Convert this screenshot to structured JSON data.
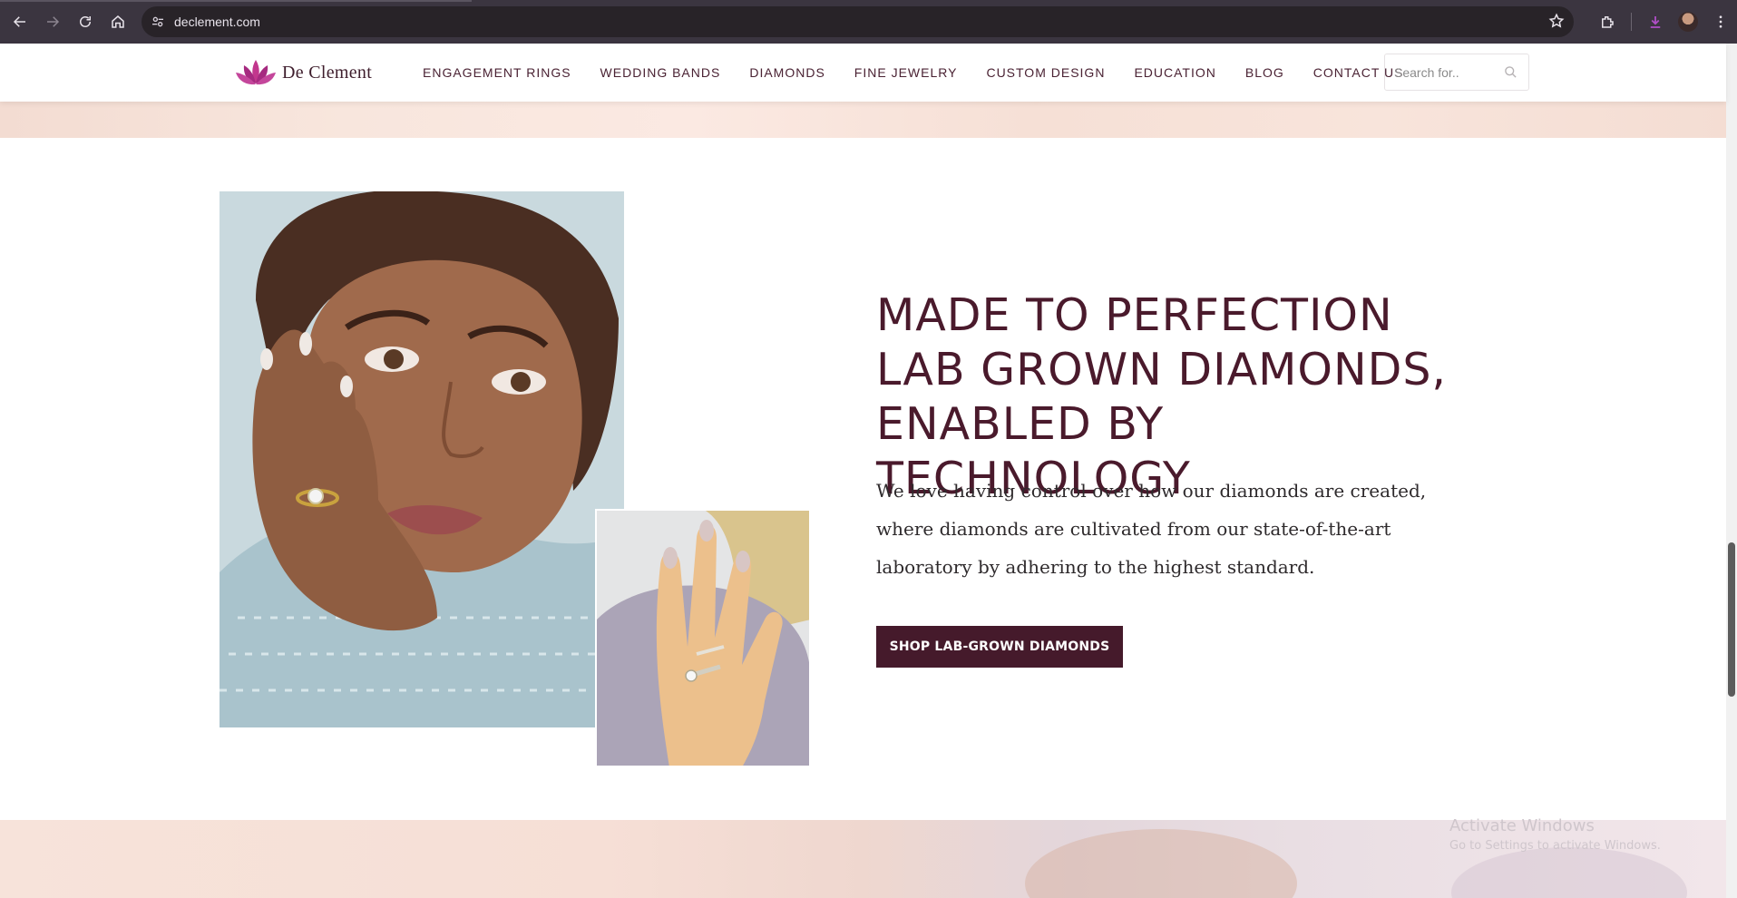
{
  "browser": {
    "url": "declement.com"
  },
  "site": {
    "logo_text": "De Clement",
    "nav": [
      "ENGAGEMENT RINGS",
      "WEDDING BANDS",
      "DIAMONDS",
      "FINE JEWELRY",
      "CUSTOM DESIGN",
      "EDUCATION",
      "BLOG",
      "CONTACT US"
    ],
    "search_placeholder": "Search for.."
  },
  "hero": {
    "headline": "MADE TO PERFECTION LAB GROWN DIAMONDS, ENABLED BY TECHNOLOGY",
    "body": "We love having control over how our diamonds are created, where diamonds are cultivated from our state-of-the-art laboratory by adhering to the highest standard.",
    "cta_label": "SHOP LAB-GROWN DIAMONDS"
  },
  "os_watermark": {
    "title": "Activate Windows",
    "subtitle": "Go to Settings to activate Windows."
  },
  "colors": {
    "brand": "#451a2b",
    "heading": "#4a1a2c",
    "browser_chrome": "#3b3540"
  }
}
